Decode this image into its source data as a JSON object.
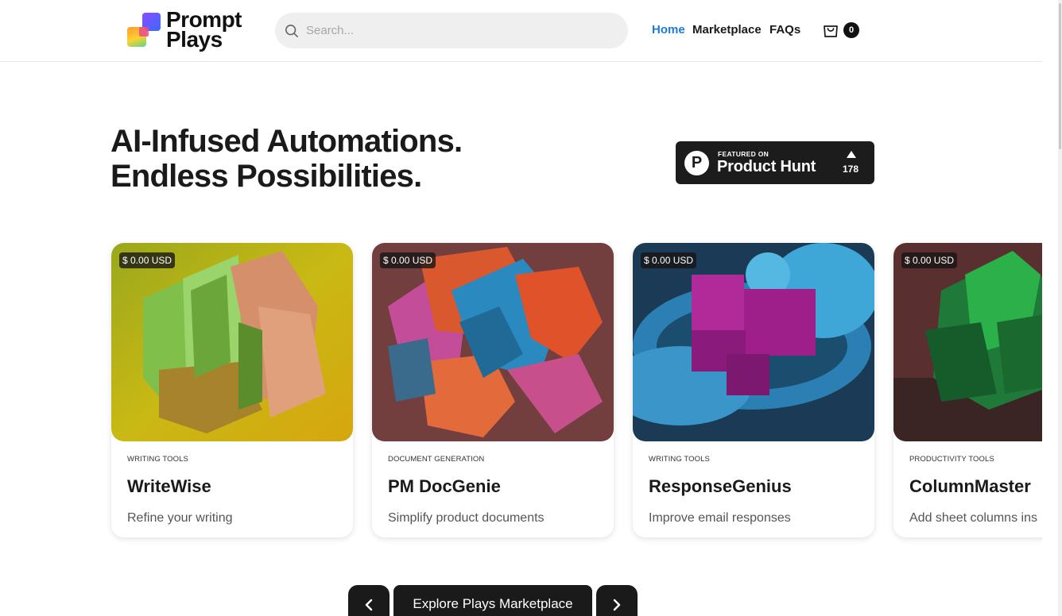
{
  "header": {
    "logo_line1": "Prompt",
    "logo_line2": "Plays",
    "search_placeholder": "Search...",
    "nav": [
      {
        "label": "Home",
        "active": true
      },
      {
        "label": "Marketplace",
        "active": false
      },
      {
        "label": "FAQs",
        "active": false
      }
    ],
    "cart_count": "0",
    "accent_color": "#1f7ad6"
  },
  "hero": {
    "line1": "AI-Infused Automations.",
    "line2": "Endless Possibilities."
  },
  "product_hunt": {
    "small": "FEATURED ON",
    "big": "Product Hunt",
    "count": "178",
    "icon": "P"
  },
  "cards": [
    {
      "price": "$ 0.00 USD",
      "category": "WRITING TOOLS",
      "title": "WriteWise",
      "description": "Refine your writing"
    },
    {
      "price": "$ 0.00 USD",
      "category": "DOCUMENT GENERATION",
      "title": "PM DocGenie",
      "description": "Simplify product documents"
    },
    {
      "price": "$ 0.00 USD",
      "category": "WRITING TOOLS",
      "title": "ResponseGenius",
      "description": "Improve email responses"
    },
    {
      "price": "$ 0.00 USD",
      "category": "PRODUCTIVITY TOOLS",
      "title": "ColumnMaster",
      "description": "Add sheet columns ins"
    }
  ],
  "controls": {
    "explore_label": "Explore Plays Marketplace"
  }
}
